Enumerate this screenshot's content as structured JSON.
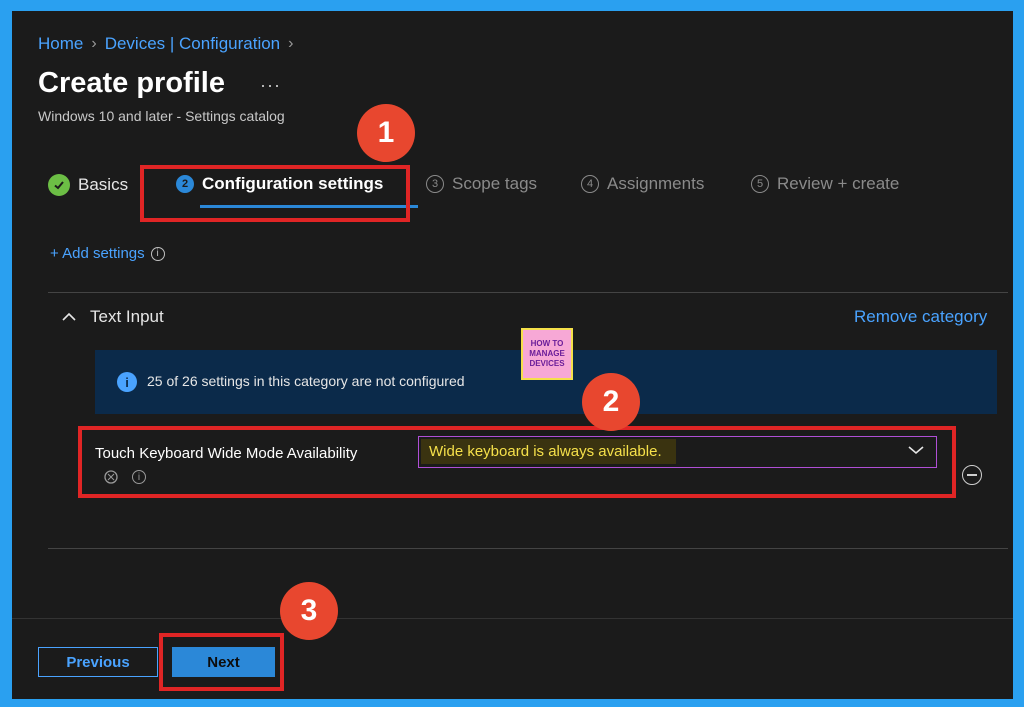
{
  "breadcrumb": {
    "home": "Home",
    "section": "Devices | Configuration"
  },
  "page": {
    "title": "Create profile",
    "more": "···",
    "subtitle": "Windows 10 and later - Settings catalog"
  },
  "wizard": {
    "tabs": [
      {
        "step": "",
        "label": "Basics",
        "state": "completed"
      },
      {
        "step": "2",
        "label": "Configuration settings",
        "state": "active"
      },
      {
        "step": "3",
        "label": "Scope tags",
        "state": "inactive"
      },
      {
        "step": "4",
        "label": "Assignments",
        "state": "inactive"
      },
      {
        "step": "5",
        "label": "Review + create",
        "state": "inactive"
      }
    ]
  },
  "add_settings": {
    "label": "+ Add settings",
    "info": "i"
  },
  "category": {
    "title": "Text Input",
    "remove_label": "Remove category",
    "banner": {
      "icon": "i",
      "text": "25 of 26 settings in this category are not configured"
    }
  },
  "setting": {
    "label": "Touch Keyboard Wide Mode Availability",
    "value": "Wide keyboard is always available."
  },
  "watermark": {
    "line1": "HOW TO",
    "line2": "MANAGE",
    "line3": "DEVICES"
  },
  "annotations": {
    "badge1": "1",
    "badge2": "2",
    "badge3": "3"
  },
  "footer": {
    "previous_label": "Previous",
    "next_label": "Next"
  },
  "colors": {
    "accent": "#2b88d8",
    "link": "#4aa3ff",
    "highlight": "#e02525",
    "background": "#1b1b1b"
  }
}
